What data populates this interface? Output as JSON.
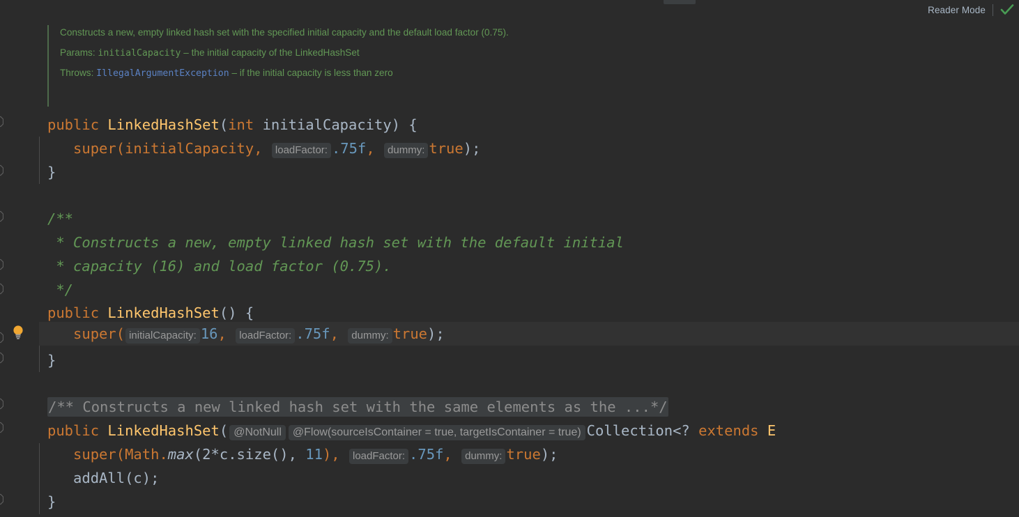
{
  "toolbar": {
    "reader_mode_label": "Reader Mode",
    "reader_mode_check_icon": "green-check-icon",
    "inspection_tab_stub": ""
  },
  "javadoc": {
    "summary": "Constructs a new, empty linked hash set with the specified initial capacity and the default load factor (0.75).",
    "params_label": "Params:",
    "param_name": "initialCapacity",
    "param_dash": " – ",
    "param_desc": "the initial capacity of the LinkedHashSet",
    "throws_label": "Throws:",
    "throws_type": "IllegalArgumentException",
    "throws_dash": " – ",
    "throws_desc": "if the initial capacity is less than zero"
  },
  "gutter": {
    "bulb_icon": "lightbulb-intention-icon",
    "fold_icon": "code-fold-tag-icon"
  },
  "code": {
    "ctor_int": {
      "kw_public": "public",
      "type_name": "LinkedHashSet",
      "open_paren": "(",
      "kw_int": "int",
      "param": " initialCapacity",
      "close_paren": ") {",
      "super_call": "super(initialCapacity,",
      "hint_loadfactor": "loadFactor:",
      "val_loadfactor": ".75f",
      "comma": ",",
      "hint_dummy": "dummy:",
      "val_dummy": "true",
      "tail": ");",
      "close_brace": "}"
    },
    "javadoc_comment": {
      "open": "/**",
      "line1": " * Constructs a new, empty linked hash set with the default initial",
      "line2": " * capacity (16) and load factor (0.75).",
      "close": " */"
    },
    "ctor_default": {
      "kw_public": "public",
      "type_name": "LinkedHashSet",
      "signature": "() {",
      "super_open": "super(",
      "hint_initialcapacity": "initialCapacity:",
      "val_initialcapacity": "16",
      "comma1": ",",
      "hint_loadfactor": "loadFactor:",
      "val_loadfactor": ".75f",
      "comma2": ",",
      "hint_dummy": "dummy:",
      "val_dummy": "true",
      "tail": ");",
      "close_brace": "}"
    },
    "ctor_collection": {
      "folded_comment": "/** Constructs a new linked hash set with the same elements as the ...*/",
      "kw_public": "public",
      "type_name": "LinkedHashSet",
      "open_paren": "(",
      "anno_notnull": "@NotNull",
      "anno_flow": "@Flow(sourceIsContainer = true, targetIsContainer = true)",
      "param_type": "Collection<?",
      "kw_extends": "extends",
      "param_type_tail": "E",
      "super_open": "super(Math.",
      "static_max": "max",
      "args": "(2*c.size(), ",
      "arg_num": "11",
      "args_close": "),",
      "hint_loadfactor": "loadFactor:",
      "val_loadfactor": ".75f",
      "comma": ",",
      "hint_dummy": "dummy:",
      "val_dummy": "true",
      "tail": ");",
      "add_all": "addAll(c);",
      "close_brace": "}"
    }
  },
  "colors": {
    "background": "#2b2b2b",
    "caret_line": "#323232",
    "keyword": "#cc7832",
    "class_name": "#ffc66d",
    "identifier": "#a9b7c6",
    "number": "#6897bb",
    "comment": "#629755",
    "inlay_chip_bg": "#3a3d3f",
    "inlay_chip_text": "#9a9a9a",
    "bulb": "#f0a732",
    "check": "#499c54"
  }
}
